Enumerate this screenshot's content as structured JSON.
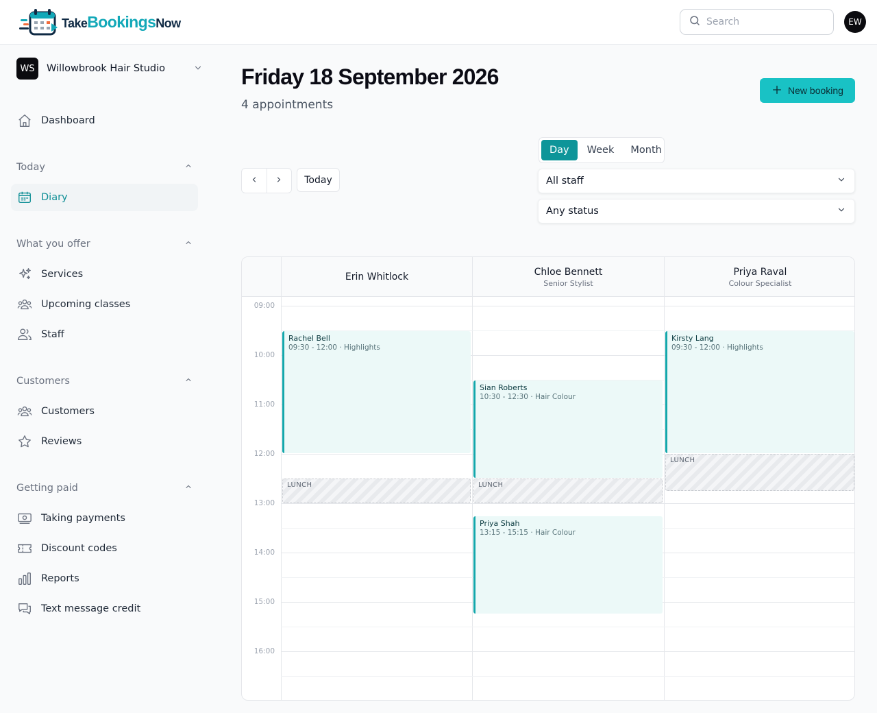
{
  "brand": {
    "part1": "Take",
    "part2": "Bookings",
    "part3": "Now"
  },
  "search": {
    "placeholder": "Search",
    "value": ""
  },
  "user": {
    "initials": "EW"
  },
  "business": {
    "initials": "WS",
    "name": "Willowbrook Hair Studio"
  },
  "sidebar": {
    "dashboard": "Dashboard",
    "sections": [
      {
        "title": "Today",
        "items": [
          "Diary"
        ]
      },
      {
        "title": "What you offer",
        "items": [
          "Services",
          "Upcoming classes",
          "Staff"
        ]
      },
      {
        "title": "Customers",
        "items": [
          "Customers",
          "Reviews"
        ]
      },
      {
        "title": "Getting paid",
        "items": [
          "Taking payments",
          "Discount codes",
          "Reports",
          "Text message credit"
        ]
      }
    ],
    "active_item": "Diary"
  },
  "page": {
    "title": "Friday 18 September 2026",
    "subtitle": "4 appointments",
    "new_booking": "New booking",
    "today_button": "Today"
  },
  "views": {
    "day": "Day",
    "week": "Week",
    "month": "Month",
    "active": "Day"
  },
  "filters": {
    "staff": "All staff",
    "status": "Any status"
  },
  "calendar": {
    "times": [
      "09:00",
      "10:00",
      "11:00",
      "12:00",
      "13:00",
      "14:00",
      "15:00",
      "16:00"
    ],
    "staff": [
      {
        "name": "Erin Whitlock",
        "role": ""
      },
      {
        "name": "Chloe Bennett",
        "role": "Senior Stylist"
      },
      {
        "name": "Priya Raval",
        "role": "Colour Specialist"
      }
    ],
    "appointments": [
      {
        "customer": "Rachel Bell",
        "detail": "09:30 - 12:00 · Highlights",
        "staff_index": 0,
        "start": "09:30",
        "end": "12:00"
      },
      {
        "customer": "Sian Roberts",
        "detail": "10:30 - 12:30 · Hair Colour",
        "staff_index": 1,
        "start": "10:30",
        "end": "12:30"
      },
      {
        "customer": "Priya Shah",
        "detail": "13:15 - 15:15 · Hair Colour",
        "staff_index": 1,
        "start": "13:15",
        "end": "15:15"
      },
      {
        "customer": "Kirsty Lang",
        "detail": "09:30 - 12:00 · Highlights",
        "staff_index": 2,
        "start": "09:30",
        "end": "12:00"
      }
    ],
    "lunch_label": "LUNCH",
    "lunches": [
      {
        "staff_index": 0,
        "start": "12:30",
        "end": "13:00"
      },
      {
        "staff_index": 1,
        "start": "12:30",
        "end": "13:00"
      },
      {
        "staff_index": 2,
        "start": "12:00",
        "end": "12:45"
      }
    ]
  },
  "colors": {
    "accent": "#19c2c5",
    "accent_dark": "#0e9599",
    "appointment_bg": "#ecf9f8"
  }
}
